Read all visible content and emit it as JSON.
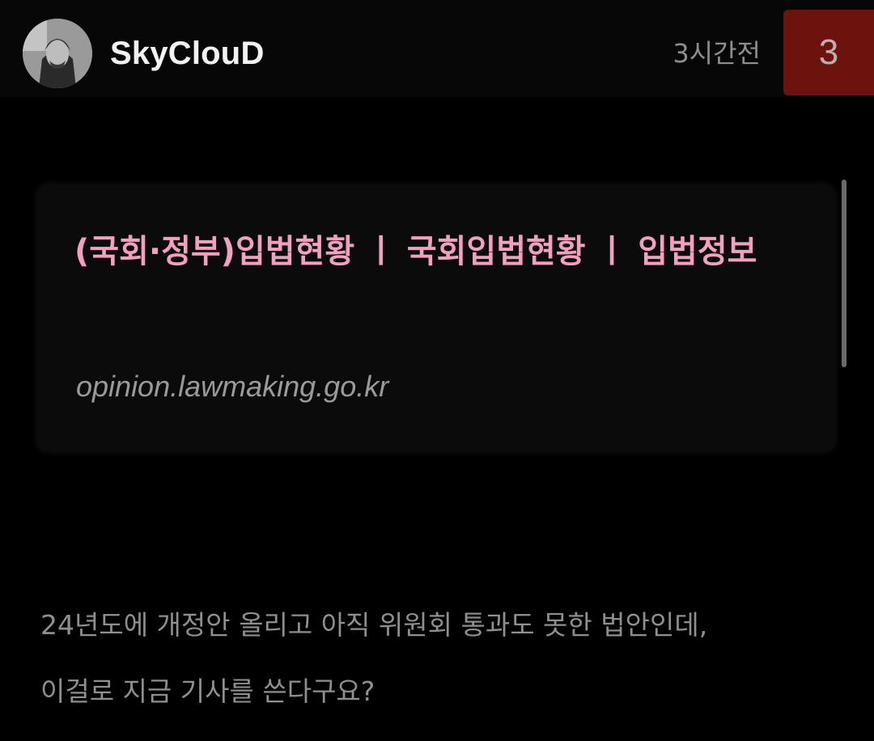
{
  "post": {
    "author": "SkyClouD",
    "avatar_icon": "user-avatar-icon",
    "time": "3시간전",
    "comment_count": "3",
    "accent_color": "#6e120d"
  },
  "link_preview": {
    "title": "(국회·정부)입법현황 ㅣ 국회입법현황 ㅣ 입법정보",
    "url": "opinion.lawmaking.go.kr",
    "title_color": "#f2a0c0"
  },
  "content": {
    "lines": [
      "24년도에 개정안 올리고 아직 위원회 통과도 못한 법안인데,",
      "이걸로 지금 기사를 쓴다구요?"
    ]
  }
}
